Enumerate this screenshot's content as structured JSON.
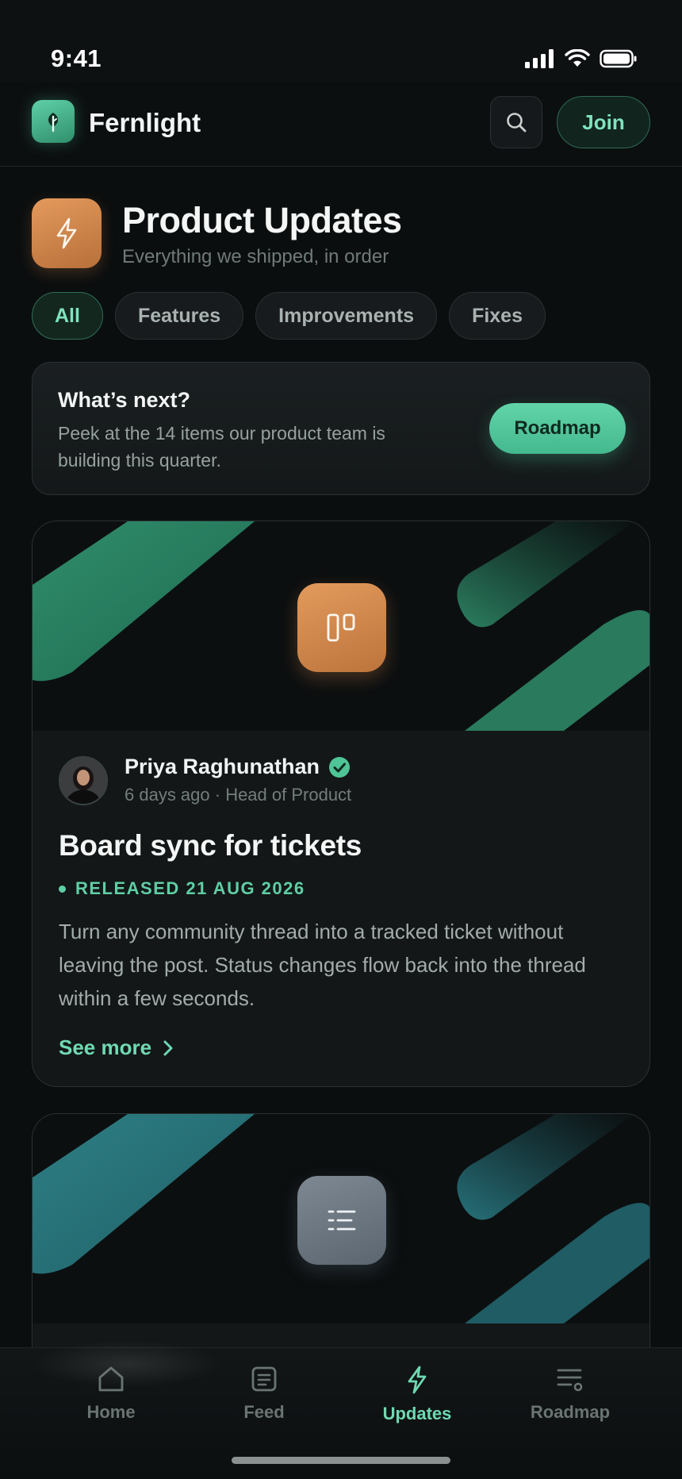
{
  "status_bar": {
    "time": "9:41"
  },
  "header": {
    "app_name": "Fernlight",
    "join_label": "Join"
  },
  "page": {
    "title": "Product Updates",
    "subtitle": "Everything we shipped, in order"
  },
  "filters": [
    {
      "label": "All",
      "active": true
    },
    {
      "label": "Features",
      "active": false
    },
    {
      "label": "Improvements",
      "active": false
    },
    {
      "label": "Fixes",
      "active": false
    }
  ],
  "promo": {
    "title": "What’s next?",
    "description": "Peek at the 14 items our product team is building this quarter.",
    "button_label": "Roadmap"
  },
  "updates": [
    {
      "icon": "kanban-board-icon",
      "icon_color": "#d9884a",
      "accent": "#2e8a6a",
      "author": "Priya Raghunathan",
      "verified": true,
      "meta": "6 days ago · Head of Product",
      "title": "Board sync for tickets",
      "release": "RELEASED 21 AUG 2026",
      "description": "Turn any community thread into a tracked ticket without leaving the post. Status changes flow back into the thread within a few seconds.",
      "see_more": "See more"
    },
    {
      "icon": "list-icon",
      "icon_color": "#6f7b86",
      "accent": "#2a7377"
    }
  ],
  "bottom_nav": [
    {
      "label": "Home",
      "icon": "home-icon",
      "active": false
    },
    {
      "label": "Feed",
      "icon": "feed-icon",
      "active": false
    },
    {
      "label": "Updates",
      "icon": "bolt-icon",
      "active": true
    },
    {
      "label": "Roadmap",
      "icon": "roadmap-icon",
      "active": false
    }
  ],
  "colors": {
    "accent": "#6fd9b2",
    "background": "#0b0e0f",
    "orange": "#d9884a"
  }
}
